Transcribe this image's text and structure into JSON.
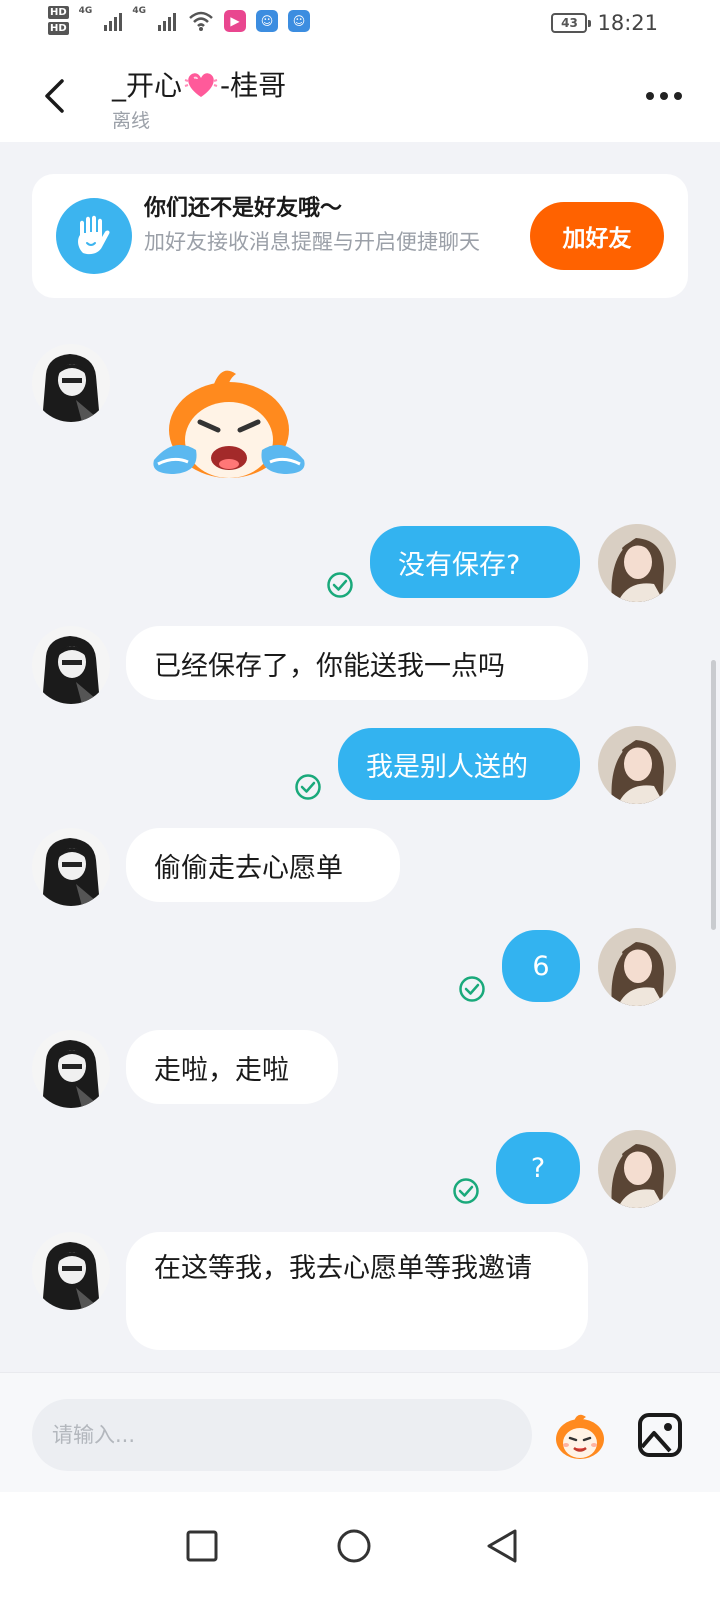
{
  "status_bar": {
    "hd1": "HD",
    "hd2": "HD",
    "net1": "4G",
    "net2": "4G",
    "battery": "43",
    "time": "18:21"
  },
  "header": {
    "title_prefix": "_开心",
    "title_suffix": "-桂哥",
    "status": "离线"
  },
  "friend_card": {
    "title": "你们还不是好友哦～",
    "subtitle": "加好友接收消息提醒与开启便捷聊天",
    "button": "加好友"
  },
  "messages": [
    {
      "direction": "in",
      "type": "sticker",
      "sticker": "crying-cartoon-sticker"
    },
    {
      "direction": "out",
      "text": "没有保存?",
      "read": true
    },
    {
      "direction": "in",
      "text": "已经保存了，你能送我一点吗"
    },
    {
      "direction": "out",
      "text": "我是别人送的",
      "read": true
    },
    {
      "direction": "in",
      "text": "偷偷走去心愿单"
    },
    {
      "direction": "out",
      "text": "6",
      "read": true
    },
    {
      "direction": "in",
      "text": "走啦，走啦"
    },
    {
      "direction": "out",
      "text": "?",
      "read": true
    },
    {
      "direction": "in",
      "text": "在这等我，我去心愿单等我邀请"
    }
  ],
  "input": {
    "placeholder": "请输入...",
    "value": ""
  },
  "icons": {
    "back": "chevron-left-icon",
    "more": "more-dots-icon",
    "emoji": "emoji-mascot-icon",
    "image": "image-icon",
    "recent": "square-icon",
    "home": "circle-icon",
    "back_nav": "triangle-back-icon"
  },
  "colors": {
    "outgoing_bubble": "#33b3f0",
    "incoming_bubble": "#ffffff",
    "add_friend_button": "#ff6200",
    "read_check": "#1aa97b",
    "background": "#f2f3f7"
  }
}
